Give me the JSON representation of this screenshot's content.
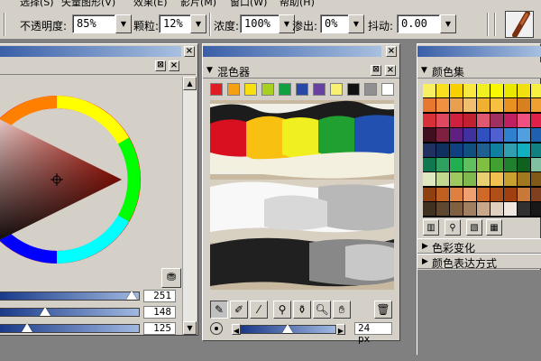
{
  "menubar": {
    "items": [
      "选择(S)",
      "矢量图形(V)",
      "效果(E)",
      "影片(M)",
      "窗口(W)",
      "帮助(H)"
    ]
  },
  "propbar": {
    "opacity_label": "不透明度:",
    "opacity_value": "85%",
    "grain_label": "颗粒:",
    "grain_value": "12%",
    "density_label": "浓度:",
    "density_value": "100%",
    "bleed_label": "渗出:",
    "bleed_value": "0%",
    "jitter_label": "抖动:",
    "jitter_value": "0.00"
  },
  "colors_panel": {
    "slider_values": [
      "251",
      "148",
      "125"
    ],
    "slider_levels": [
      0.98,
      0.58,
      0.49
    ]
  },
  "mixer_panel": {
    "title": "混色器",
    "swatches": [
      "#e01c24",
      "#f4a010",
      "#f8e010",
      "#a8d020",
      "#10a040",
      "#2848a8",
      "#6840a0",
      "#f8f070",
      "#101010",
      "#909090",
      "#ffffff"
    ],
    "tools": [
      "mixer-brush-icon",
      "apply-brush-icon",
      "knife-icon",
      "dropper-icon",
      "sample-dropper-icon",
      "zoom-icon",
      "hand-icon"
    ],
    "brush_size": "24 px",
    "brush_size_level": 0.45
  },
  "colorset_panel": {
    "title": "颜色集",
    "sections": [
      "色彩变化",
      "颜色表达方式"
    ],
    "grid": [
      [
        "#f8f060",
        "#f8e020",
        "#f8d000",
        "#f8e840",
        "#f0f020",
        "#f8f800",
        "#e8e800",
        "#f0e010",
        "#f8f040"
      ],
      [
        "#e87830",
        "#f09040",
        "#e8a050",
        "#f0c070",
        "#f0b030",
        "#f8c040",
        "#e89020",
        "#d88020",
        "#f0a030"
      ],
      [
        "#d83038",
        "#e04860",
        "#d02040",
        "#c02030",
        "#e05870",
        "#a03060",
        "#c02060",
        "#f05080",
        "#e02048"
      ],
      [
        "#401020",
        "#802040",
        "#602080",
        "#4030a0",
        "#3050c0",
        "#5060d0",
        "#3080d0",
        "#50a0e0",
        "#2060b0"
      ],
      [
        "#203060",
        "#103060",
        "#104080",
        "#105080",
        "#206090",
        "#1080a0",
        "#30a0b0",
        "#10b0c0",
        "#108080"
      ],
      [
        "#107850",
        "#30a060",
        "#20b050",
        "#60c060",
        "#80c040",
        "#40a030",
        "#208030",
        "#106020",
        "#80c0a0"
      ],
      [
        "#e0e8c0",
        "#c0d890",
        "#a0c860",
        "#80b850",
        "#e8d070",
        "#f0c050",
        "#c8a030",
        "#a07820",
        "#805818"
      ],
      [
        "#904010",
        "#c06020",
        "#e08040",
        "#f0a070",
        "#d06828",
        "#b05018",
        "#a04010",
        "#c87838",
        "#804020"
      ],
      [
        "#403020",
        "#604830",
        "#806040",
        "#a08060",
        "#c8a888",
        "#e0d0c0",
        "#f0e8e0",
        "#303030",
        "#181818"
      ]
    ],
    "tools": [
      "library-icon",
      "add-color-icon",
      "delete-color-icon",
      "palette-view-icon"
    ]
  }
}
